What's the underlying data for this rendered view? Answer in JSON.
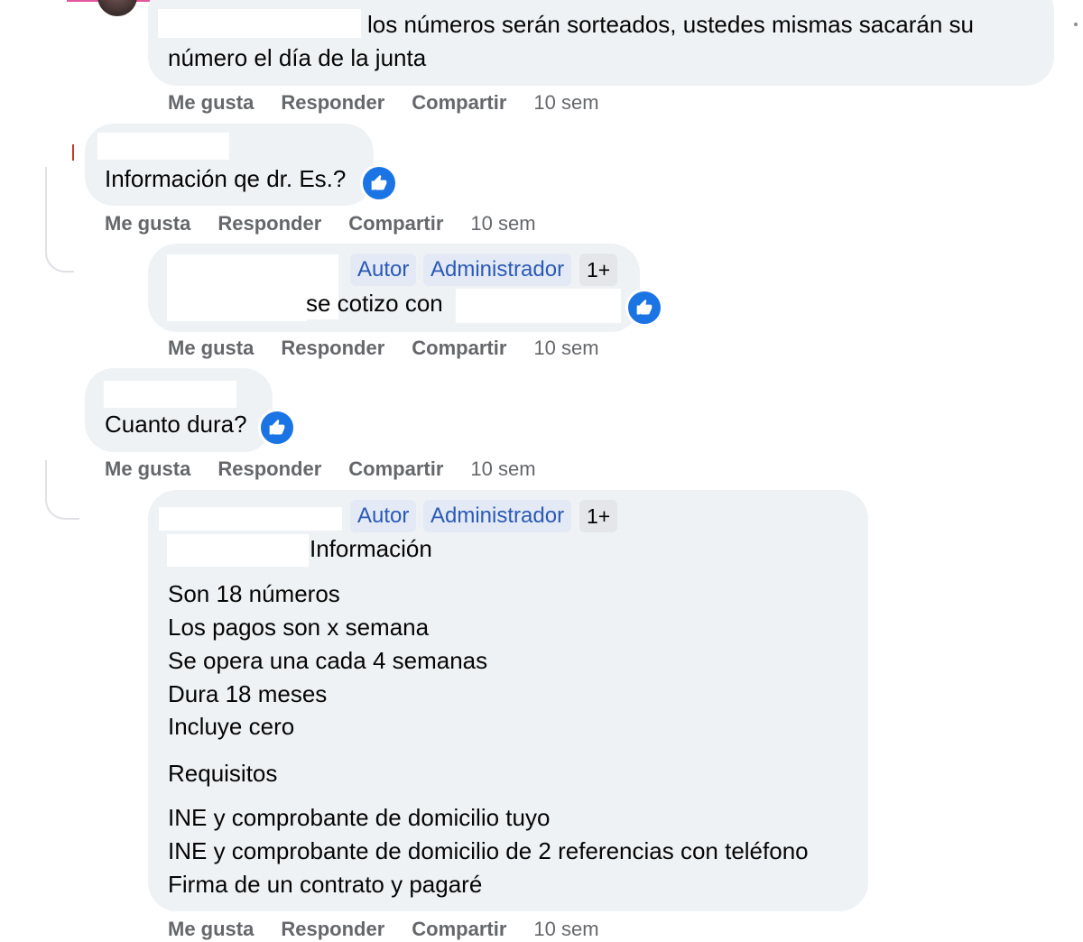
{
  "actions": {
    "like": "Me gusta",
    "reply": "Responder",
    "share": "Compartir"
  },
  "comments": [
    {
      "lines": [
        "los números serán sorteados, ustedes mismas sacarán su",
        "número el día de la junta"
      ],
      "time": "10 sem"
    },
    {
      "text": "Información qe dr. Es.?",
      "time": "10 sem"
    },
    {
      "badges": [
        "Autor",
        "Administrador",
        "1+"
      ],
      "text": "se cotizo con",
      "time": "10 sem"
    },
    {
      "text": "Cuanto dura?",
      "time": "10 sem"
    },
    {
      "badges": [
        "Autor",
        "Administrador",
        "1+"
      ],
      "heading": "Información",
      "paragraph1": [
        "Son 18 números",
        "Los pagos son x semana",
        "Se opera una cada 4 semanas",
        "Dura 18 meses",
        "Incluye cero"
      ],
      "paragraph2": "Requisitos",
      "paragraph3": [
        "INE y comprobante de domicilio tuyo",
        "INE y comprobante de domicilio de 2 referencias con teléfono",
        "Firma de un contrato y pagaré"
      ],
      "time": "10 sem"
    }
  ],
  "colors": {
    "bubble": "#eff2f5",
    "badge_bg": "#e3eaf5",
    "badge_text": "#2b59b6",
    "like_blue": "#1b74e4",
    "action_gray": "#65676b"
  },
  "icons": {
    "reaction": "thumbs-up-icon"
  }
}
